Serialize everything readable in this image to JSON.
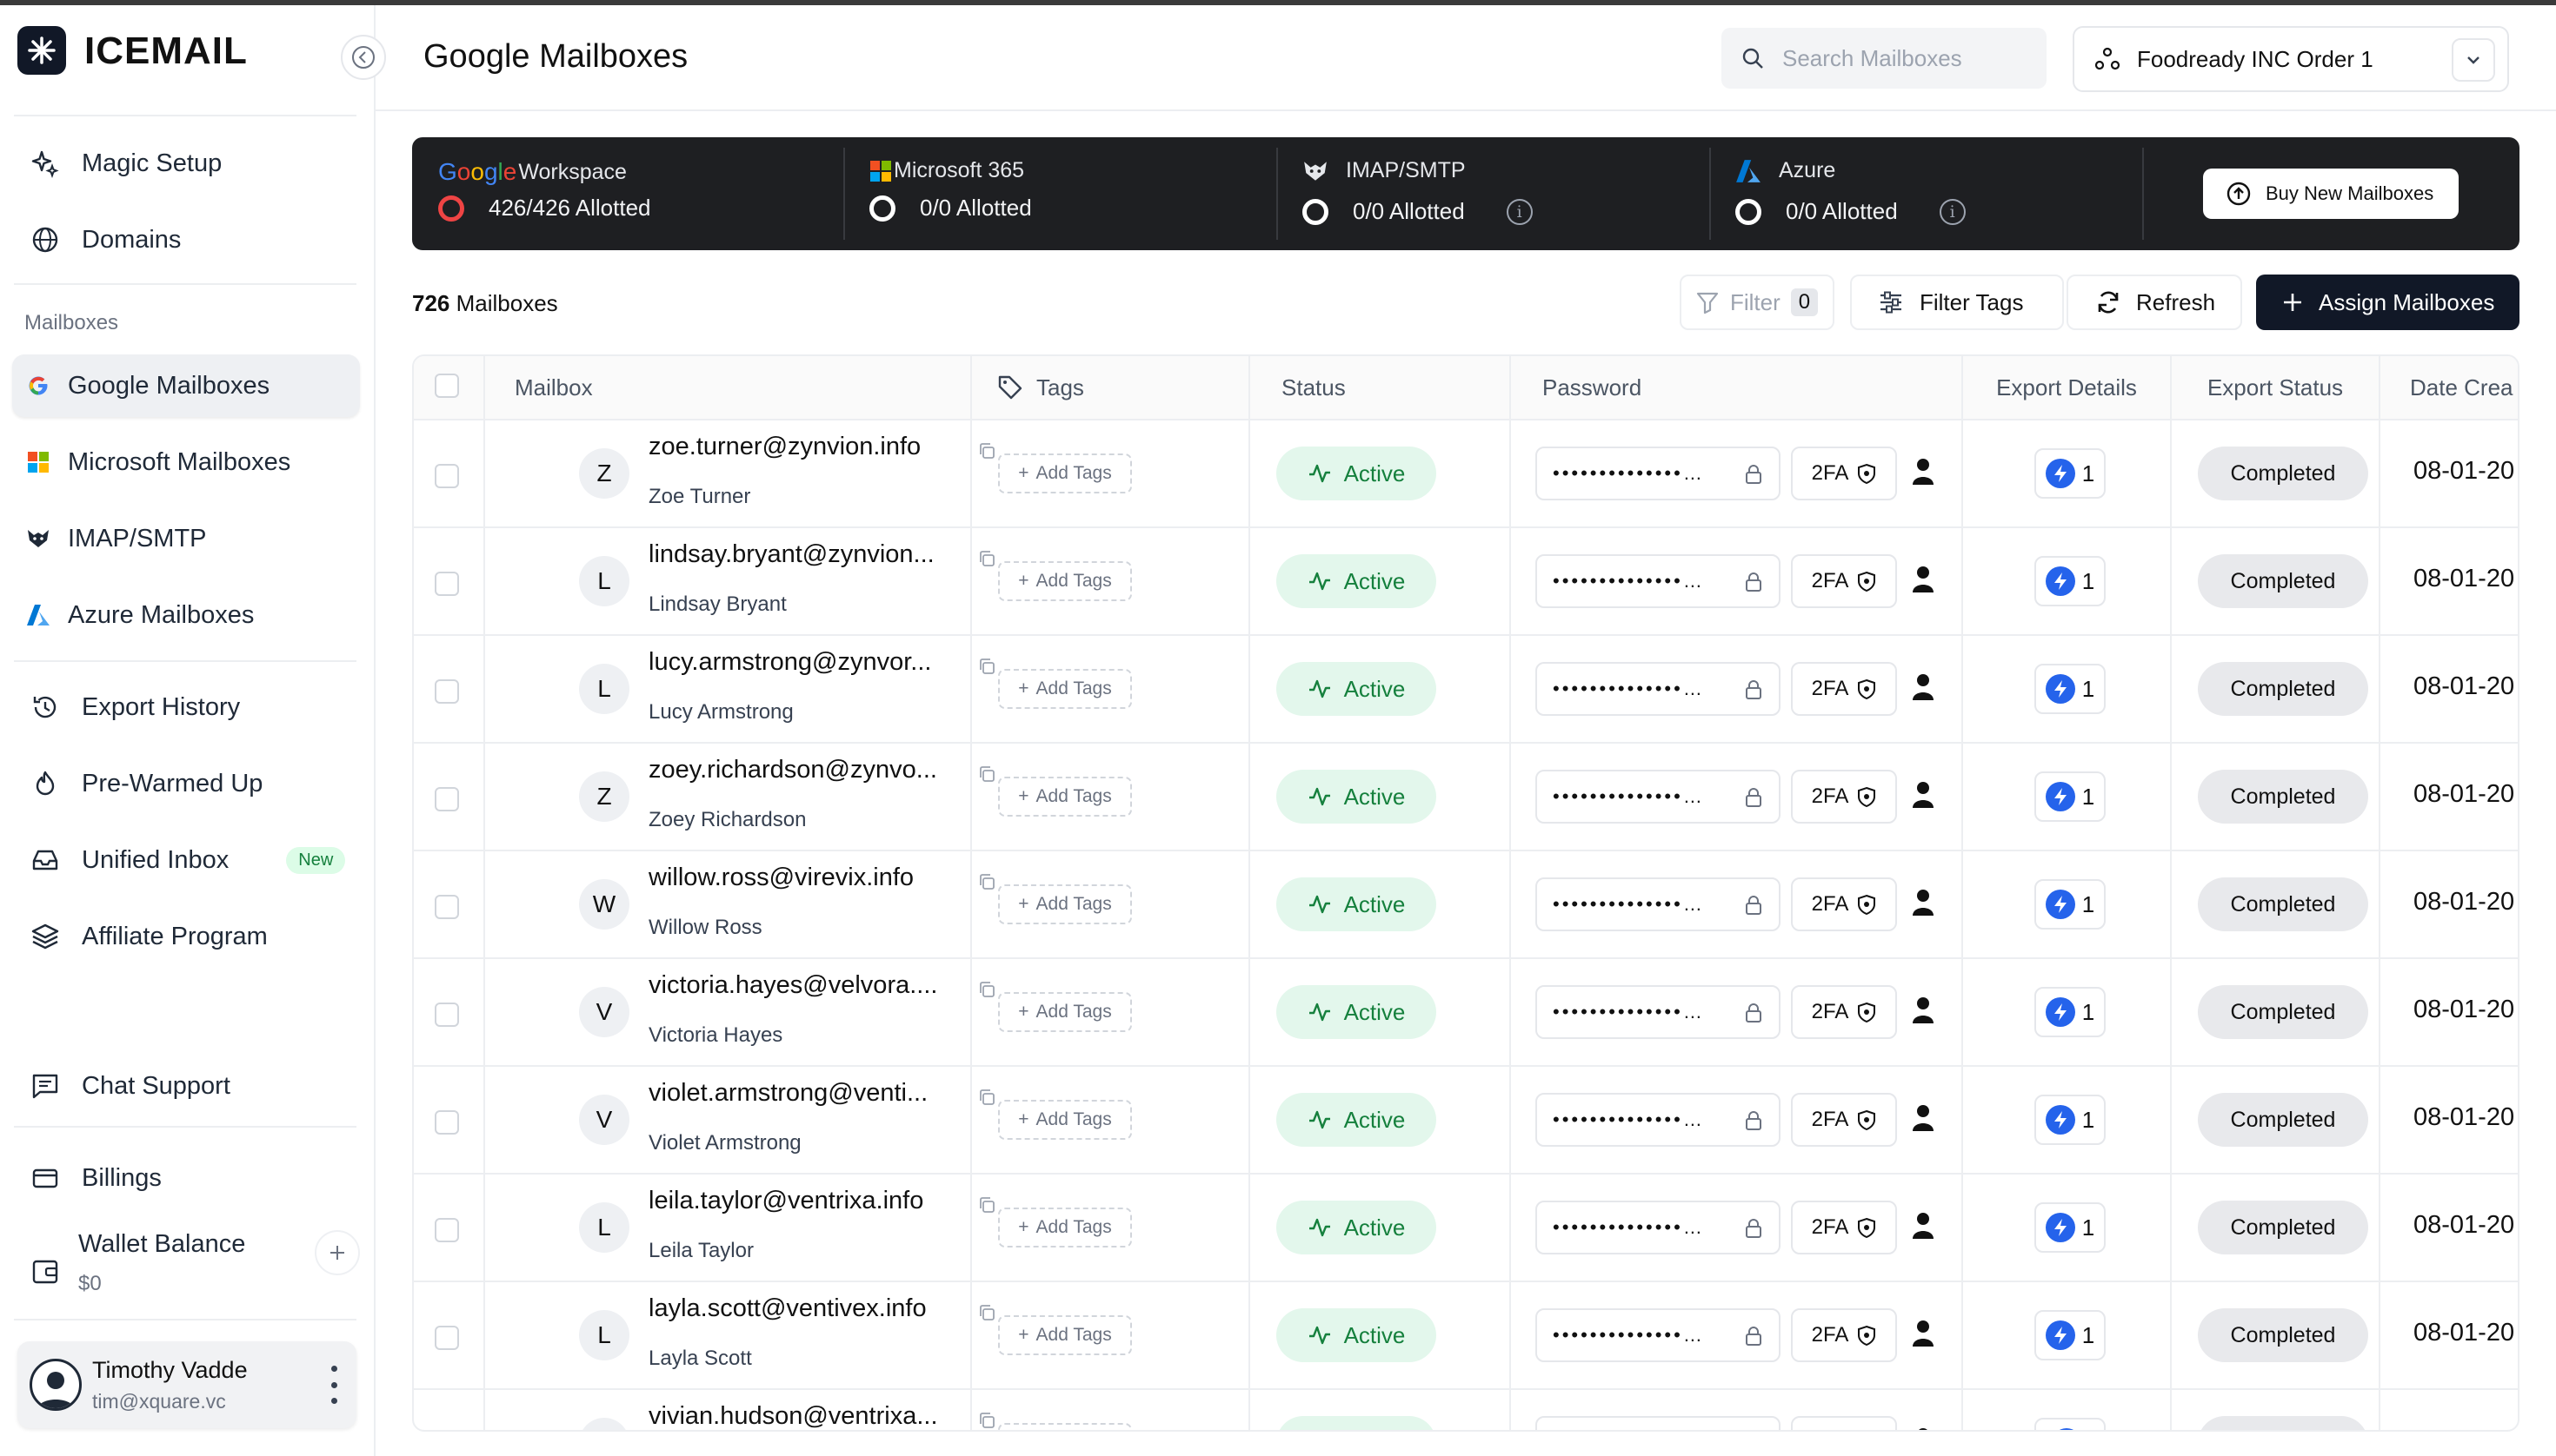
{
  "app": {
    "name": "ICEMAIL"
  },
  "sidebar": {
    "top_items": [
      {
        "label": "Magic Setup",
        "icon": "sparkles-icon"
      },
      {
        "label": "Domains",
        "icon": "globe-icon"
      }
    ],
    "section_label": "Mailboxes",
    "mailbox_items": [
      {
        "label": "Google Mailboxes",
        "icon": "google-icon",
        "active": true
      },
      {
        "label": "Microsoft Mailboxes",
        "icon": "microsoft-icon"
      },
      {
        "label": "IMAP/SMTP",
        "icon": "imap-icon"
      },
      {
        "label": "Azure Mailboxes",
        "icon": "azure-icon"
      }
    ],
    "tool_items": [
      {
        "label": "Export History",
        "icon": "history-icon"
      },
      {
        "label": "Pre-Warmed Up",
        "icon": "flame-icon"
      },
      {
        "label": "Unified Inbox",
        "icon": "inbox-icon",
        "badge": "New"
      },
      {
        "label": "Affiliate Program",
        "icon": "layers-icon"
      }
    ],
    "chat_support": "Chat Support",
    "billings": "Billings",
    "wallet": {
      "label": "Wallet Balance",
      "value": "$0"
    },
    "user": {
      "name": "Timothy Vadde",
      "email": "tim@xquare.vc"
    }
  },
  "header": {
    "title": "Google Mailboxes",
    "search_placeholder": "Search Mailboxes",
    "org": "Foodready INC Order 1"
  },
  "providers": [
    {
      "name": "Workspace",
      "brand": "Google",
      "allotted": "426/426 Allotted"
    },
    {
      "name": "Microsoft 365",
      "allotted": "0/0 Allotted"
    },
    {
      "name": "IMAP/SMTP",
      "allotted": "0/0 Allotted"
    },
    {
      "name": "Azure",
      "allotted": "0/0 Allotted"
    }
  ],
  "buy_button": "Buy New Mailboxes",
  "toolbar": {
    "count_number": "726",
    "count_label": "Mailboxes",
    "filter": "Filter",
    "filter_count": "0",
    "filter_tags": "Filter Tags",
    "refresh": "Refresh",
    "assign": "Assign Mailboxes"
  },
  "table": {
    "columns": [
      "Mailbox",
      "Tags",
      "Status",
      "Password",
      "Export Details",
      "Export Status",
      "Date Crea"
    ],
    "add_tags": "Add Tags",
    "twofa": "2FA",
    "password_mask": "••••••••••••••",
    "rows": [
      {
        "initial": "Z",
        "email": "zoe.turner@zynvion.info",
        "name": "Zoe Turner",
        "status": "Active",
        "export": "1",
        "export_status": "Completed",
        "date": "08-01-20"
      },
      {
        "initial": "L",
        "email": "lindsay.bryant@zynvion...",
        "name": "Lindsay Bryant",
        "status": "Active",
        "export": "1",
        "export_status": "Completed",
        "date": "08-01-20"
      },
      {
        "initial": "L",
        "email": "lucy.armstrong@zynvor...",
        "name": "Lucy Armstrong",
        "status": "Active",
        "export": "1",
        "export_status": "Completed",
        "date": "08-01-20"
      },
      {
        "initial": "Z",
        "email": "zoey.richardson@zynvo...",
        "name": "Zoey Richardson",
        "status": "Active",
        "export": "1",
        "export_status": "Completed",
        "date": "08-01-20"
      },
      {
        "initial": "W",
        "email": "willow.ross@virevix.info",
        "name": "Willow Ross",
        "status": "Active",
        "export": "1",
        "export_status": "Completed",
        "date": "08-01-20"
      },
      {
        "initial": "V",
        "email": "victoria.hayes@velvora....",
        "name": "Victoria Hayes",
        "status": "Active",
        "export": "1",
        "export_status": "Completed",
        "date": "08-01-20"
      },
      {
        "initial": "V",
        "email": "violet.armstrong@venti...",
        "name": "Violet Armstrong",
        "status": "Active",
        "export": "1",
        "export_status": "Completed",
        "date": "08-01-20"
      },
      {
        "initial": "L",
        "email": "leila.taylor@ventrixa.info",
        "name": "Leila Taylor",
        "status": "Active",
        "export": "1",
        "export_status": "Completed",
        "date": "08-01-20"
      },
      {
        "initial": "L",
        "email": "layla.scott@ventivex.info",
        "name": "Layla Scott",
        "status": "Active",
        "export": "1",
        "export_status": "Completed",
        "date": "08-01-20"
      },
      {
        "initial": "V",
        "email": "vivian.hudson@ventrixa...",
        "name": "",
        "status": "",
        "export": "",
        "export_status": "",
        "date": ""
      }
    ]
  },
  "colors": {
    "accent": "#111827",
    "active_bg": "#e3f7ec",
    "active_text": "#15803d",
    "provider_bar": "#1e1f22"
  }
}
